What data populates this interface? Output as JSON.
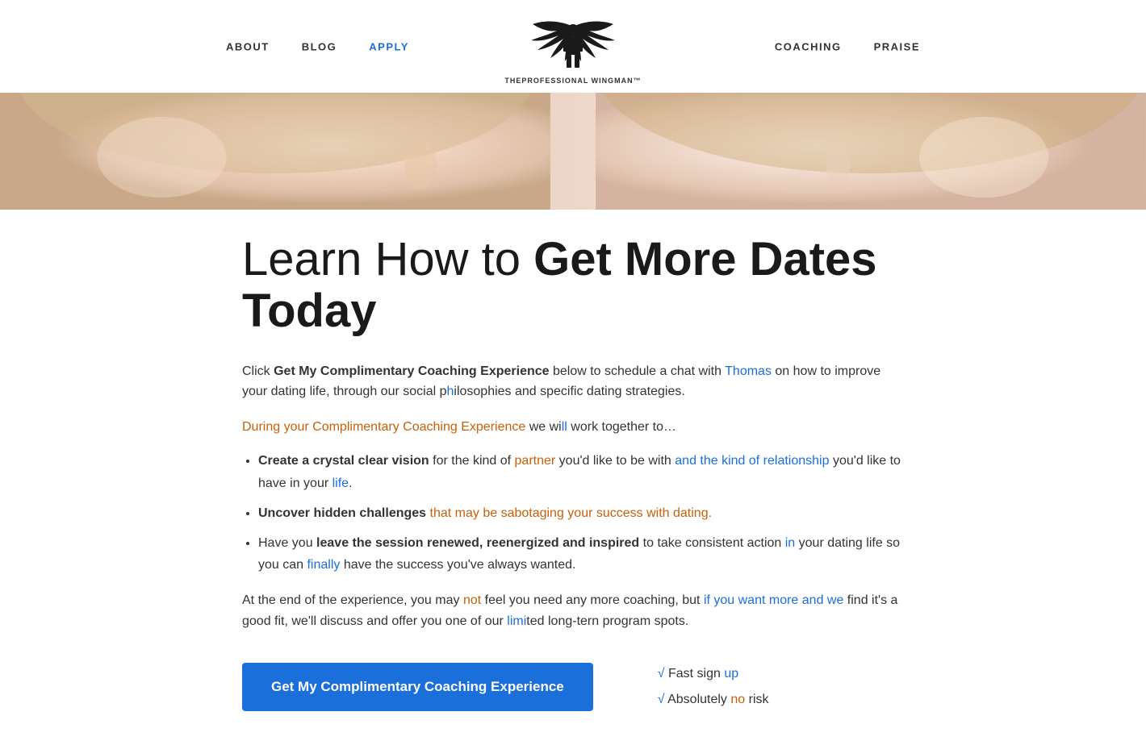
{
  "nav": {
    "links_left": [
      {
        "label": "ABOUT",
        "active": false
      },
      {
        "label": "BLOG",
        "active": false
      },
      {
        "label": "APPLY",
        "active": true
      }
    ],
    "links_right": [
      {
        "label": "COACHING",
        "active": false
      },
      {
        "label": "PRAISE",
        "active": false
      }
    ],
    "logo_line1": "The",
    "logo_line2": "PROFESSIONAL WINGMAN™"
  },
  "hero": {
    "alt": "Two people facing each other"
  },
  "main": {
    "headline_regular": "Learn How to ",
    "headline_bold": "Get More Dates Today",
    "paragraph1_parts": [
      {
        "text": "Click ",
        "style": "normal"
      },
      {
        "text": "Get My Complimentary Coaching Experience",
        "style": "bold"
      },
      {
        "text": " below to schedule a chat with Thomas on how to improve your dating life, through our social philosophies and specific dating strategies.",
        "style": "normal"
      }
    ],
    "paragraph2": "During your Complimentary Coaching Experience we will work together to…",
    "bullets": [
      {
        "bold": "Create a crystal clear vision",
        "rest": " for the kind of partner you'd like to be with and the kind of relationship you'd like to have in your life."
      },
      {
        "bold": "Uncover hidden challenges",
        "rest": " that may be sabotaging your success with dating."
      },
      {
        "bold_prefix": "Have you ",
        "bold": "leave the session renewed, reenergized and inspired",
        "rest": " to take consistent action in your dating life so you can finally have the success you've always wanted."
      }
    ],
    "closing": "At the end of the experience, you may not feel you need any more coaching, but if you want more and we find it's a good fit, we'll discuss and offer you one of our limited long-tern program spots.",
    "cta_button": "Get My Complimentary Coaching Experience",
    "trust1": "√ Fast sign up",
    "trust2": "√ Absolutely no risk"
  }
}
